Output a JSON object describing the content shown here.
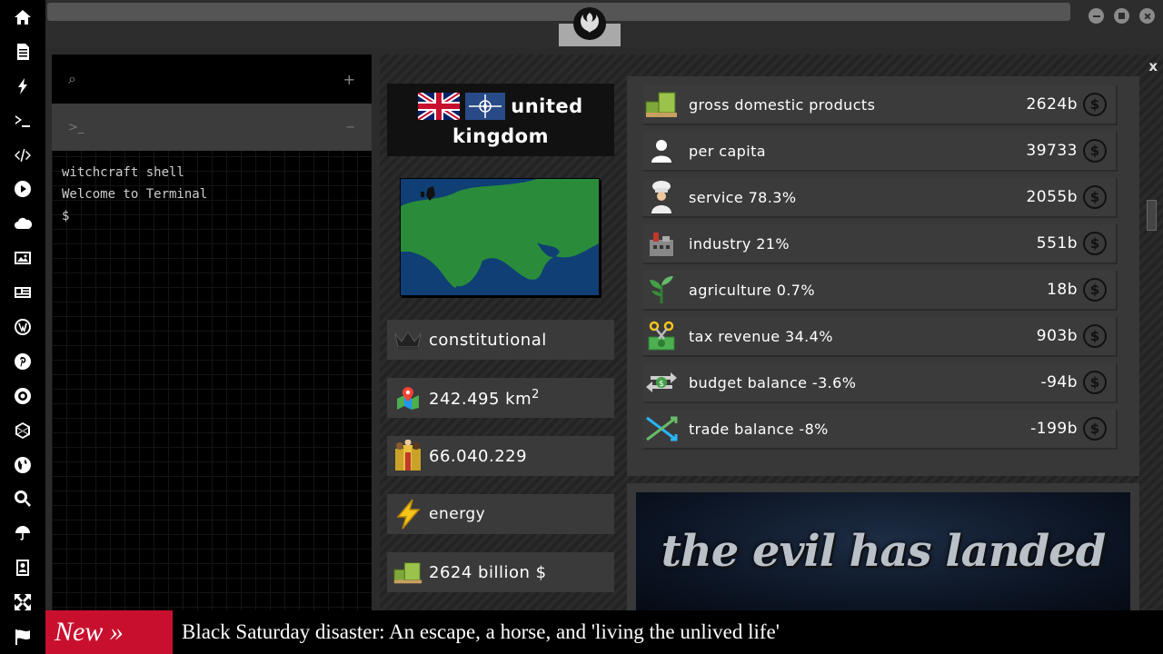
{
  "sidebar": {
    "icons": [
      "home-icon",
      "document-icon",
      "bolt-icon",
      "terminal-icon",
      "code-icon",
      "play-icon",
      "cloud-icon",
      "image-icon",
      "news-icon",
      "wordpress-icon",
      "pinterest-icon",
      "rebel-icon",
      "globe-mesh-icon",
      "globe-icon",
      "search-icon",
      "umbrella-icon",
      "contacts-icon",
      "expand-icon",
      "flag-icon"
    ]
  },
  "terminal": {
    "search_icon": "⌕",
    "add_label": "+",
    "tab_label": ">_",
    "tab_close": "−",
    "lines": [
      "witchcraft shell",
      "Welcome to Terminal",
      "$"
    ]
  },
  "panel": {
    "close_label": "x",
    "country": {
      "name_line1": "united",
      "name_line2": "kingdom"
    },
    "info": {
      "government": "constitutional",
      "area_value": "242.495 km",
      "area_sup": "2",
      "population": "66.040.229",
      "resource": "energy",
      "gdp": "2624 billion $"
    },
    "economy": [
      {
        "label": "gross domestic products",
        "value": "2624b",
        "icon": "money-stack-icon"
      },
      {
        "label": "per capita",
        "value": "39733",
        "icon": "person-icon"
      },
      {
        "label": "service 78.3%",
        "value": "2055b",
        "icon": "chef-icon"
      },
      {
        "label": "industry 21%",
        "value": "551b",
        "icon": "factory-icon"
      },
      {
        "label": "agriculture 0.7%",
        "value": "18b",
        "icon": "plant-icon"
      },
      {
        "label": "tax revenue 34.4%",
        "value": "903b",
        "icon": "scissors-money-icon"
      },
      {
        "label": "budget balance -3.6%",
        "value": "-94b",
        "icon": "exchange-icon"
      },
      {
        "label": "trade balance -8%",
        "value": "-199b",
        "icon": "trade-icon"
      }
    ],
    "currency_symbol": "$",
    "promo_text": "the evil has landed"
  },
  "ticker": {
    "label": "New »",
    "headline": "Black Saturday disaster: An escape, a horse, and 'living the unlived life'"
  },
  "colors": {
    "ticker_red": "#c8102e",
    "panel_bg": "#242424",
    "row_bg": "#3b3b3b"
  }
}
